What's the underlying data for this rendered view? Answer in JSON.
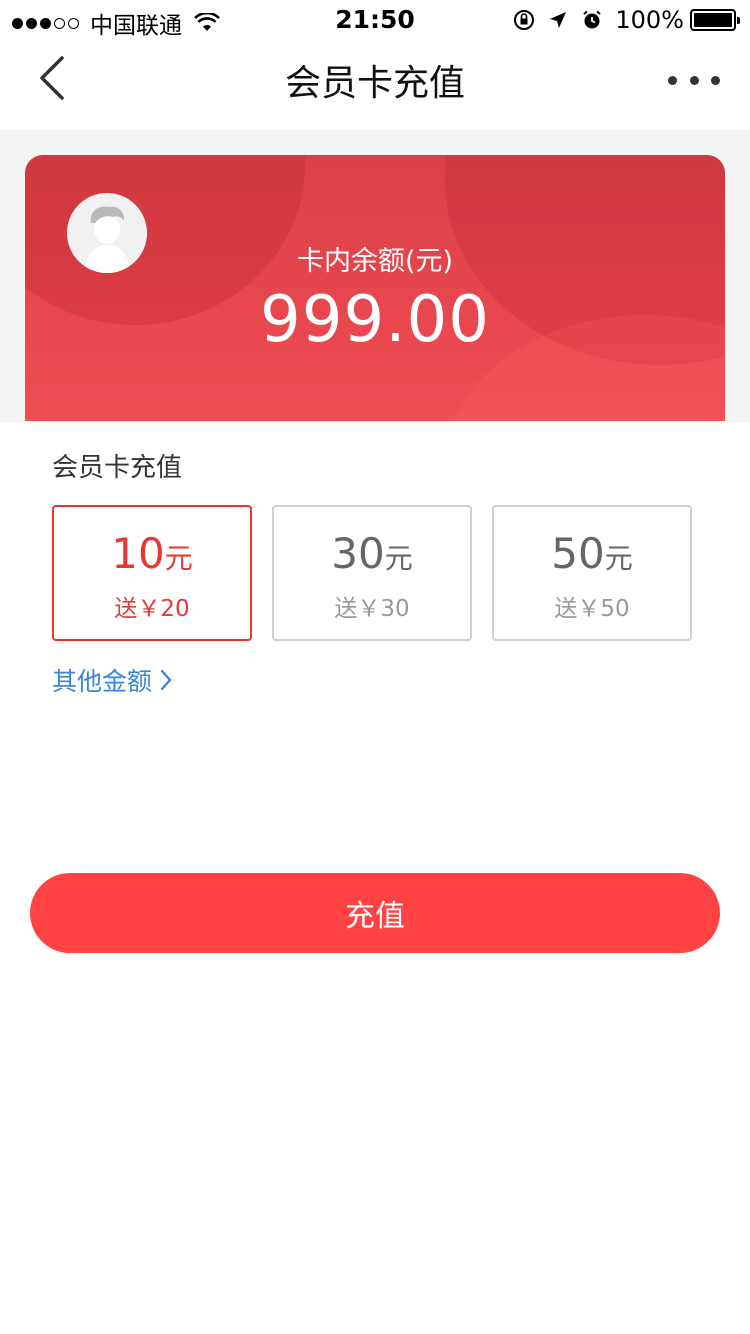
{
  "status_bar": {
    "carrier": "中国联通",
    "time": "21:50",
    "battery": "100%"
  },
  "nav": {
    "title": "会员卡充值"
  },
  "card": {
    "balance_label": "卡内余额(元)",
    "balance_value": "999.00"
  },
  "recharge": {
    "section_title": "会员卡充值",
    "options": [
      {
        "amount": "10",
        "unit": "元",
        "bonus": "送￥20",
        "selected": true
      },
      {
        "amount": "30",
        "unit": "元",
        "bonus": "送￥30",
        "selected": false
      },
      {
        "amount": "50",
        "unit": "元",
        "bonus": "送￥50",
        "selected": false
      }
    ],
    "other_amount": "其他金额",
    "submit_label": "充值"
  },
  "colors": {
    "accent": "#ff4242",
    "selected_border": "#e53935",
    "link": "#3a86d8"
  }
}
